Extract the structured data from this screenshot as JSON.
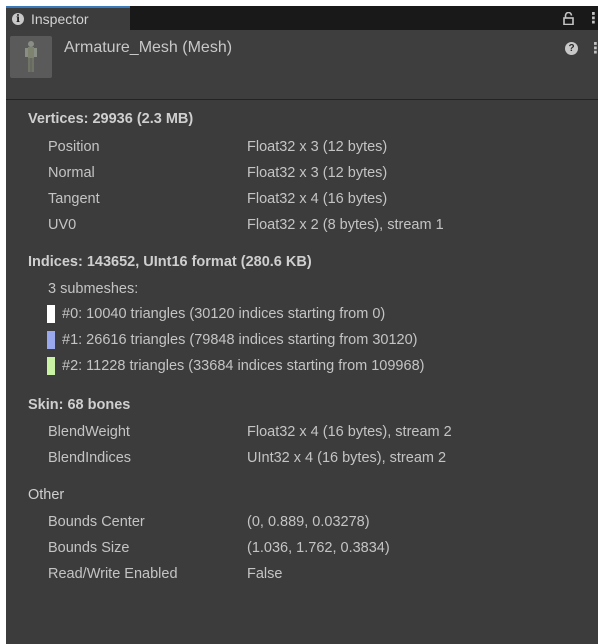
{
  "window": {
    "tab_label": "Inspector",
    "tab_icon": "info-icon",
    "accent_color": "#3a79bb"
  },
  "header": {
    "title": "Armature_Mesh (Mesh)"
  },
  "vertices": {
    "title": "Vertices: 29936 (2.3 MB)",
    "rows": [
      {
        "key": "Position",
        "value": "Float32 x 3 (12 bytes)"
      },
      {
        "key": "Normal",
        "value": "Float32 x 3 (12 bytes)"
      },
      {
        "key": "Tangent",
        "value": "Float32 x 4 (16 bytes)"
      },
      {
        "key": "UV0",
        "value": "Float32 x 2 (8 bytes), stream 1"
      }
    ]
  },
  "indices": {
    "title": "Indices: 143652, UInt16 format (280.6 KB)",
    "submesh_count": "3 submeshes:",
    "submeshes": [
      {
        "text": "#0: 10040 triangles (30120 indices starting from 0)",
        "color": "#ffffff"
      },
      {
        "text": "#1: 26616 triangles (79848 indices starting from 30120)",
        "color": "#9aa8ee"
      },
      {
        "text": "#2: 11228 triangles (33684 indices starting from 109968)",
        "color": "#c9f2a4"
      }
    ]
  },
  "skin": {
    "title": "Skin: 68 bones",
    "rows": [
      {
        "key": "BlendWeight",
        "value": "Float32 x 4 (16 bytes), stream 2"
      },
      {
        "key": "BlendIndices",
        "value": "UInt32 x 4 (16 bytes), stream 2"
      }
    ]
  },
  "other": {
    "title": "Other",
    "rows": [
      {
        "key": "Bounds Center",
        "value": "(0, 0.889, 0.03278)"
      },
      {
        "key": "Bounds Size",
        "value": "(1.036, 1.762, 0.3834)"
      },
      {
        "key": "Read/Write Enabled",
        "value": "False"
      }
    ]
  }
}
